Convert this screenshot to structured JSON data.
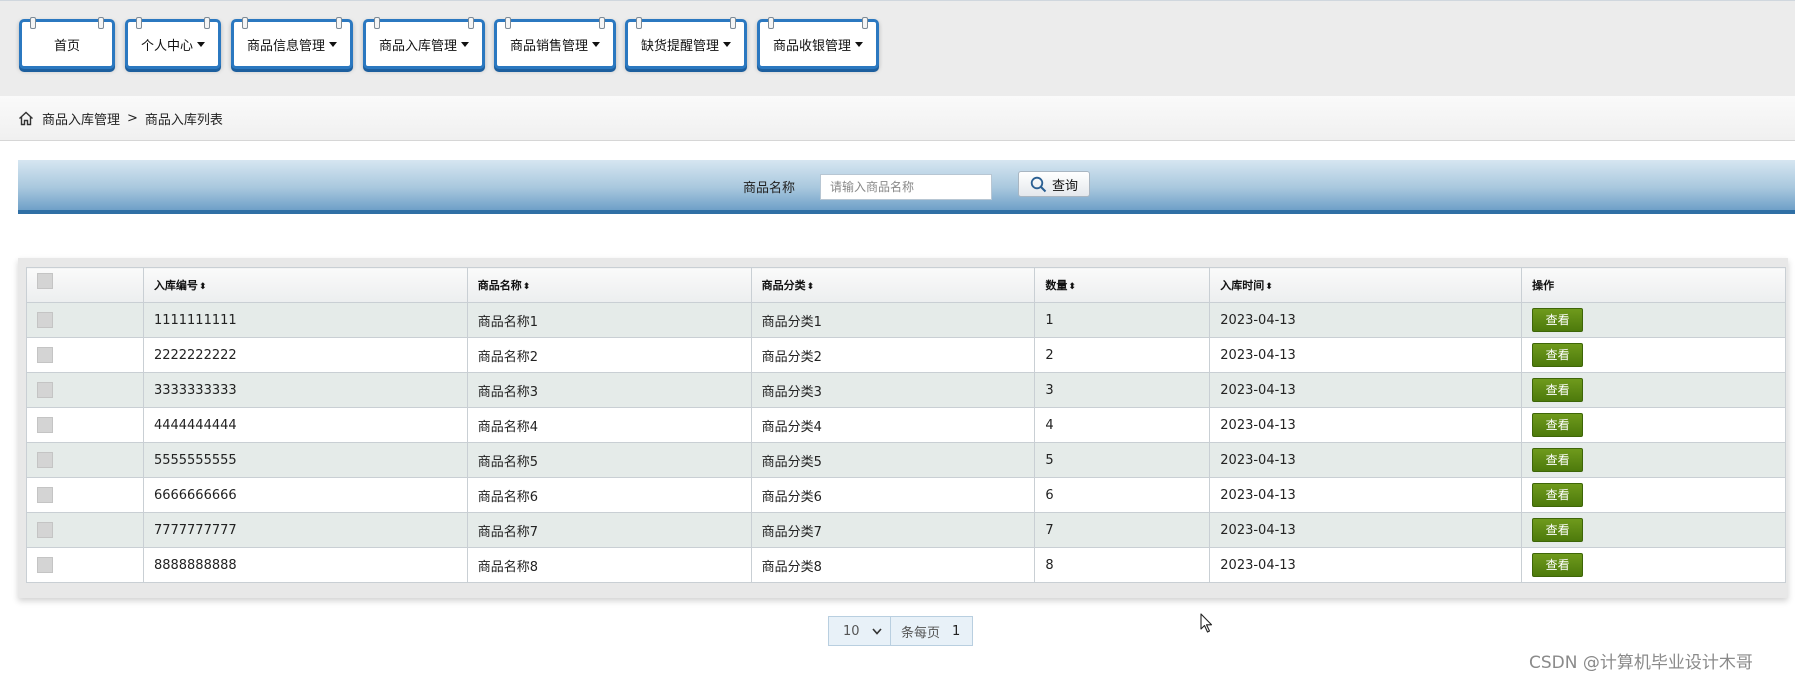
{
  "nav": {
    "tabs": [
      {
        "label": "首页",
        "has_dropdown": false
      },
      {
        "label": "个人中心",
        "has_dropdown": true
      },
      {
        "label": "商品信息管理",
        "has_dropdown": true
      },
      {
        "label": "商品入库管理",
        "has_dropdown": true
      },
      {
        "label": "商品销售管理",
        "has_dropdown": true
      },
      {
        "label": "缺货提醒管理",
        "has_dropdown": true
      },
      {
        "label": "商品收银管理",
        "has_dropdown": true
      }
    ]
  },
  "breadcrumb": {
    "icon": "home-icon",
    "items": [
      "商品入库管理",
      "商品入库列表"
    ],
    "separator": ">"
  },
  "search": {
    "label": "商品名称",
    "placeholder": "请输入商品名称",
    "value": "",
    "button_label": "查询",
    "button_icon": "search-icon"
  },
  "table": {
    "columns": [
      "",
      "入库编号",
      "商品名称",
      "商品分类",
      "数量",
      "入库时间",
      "操作"
    ],
    "sort_mark": "⬍",
    "rows": [
      {
        "id": "1111111111",
        "name": "商品名称1",
        "category": "商品分类1",
        "qty": "1",
        "time": "2023-04-13",
        "action": "查看"
      },
      {
        "id": "2222222222",
        "name": "商品名称2",
        "category": "商品分类2",
        "qty": "2",
        "time": "2023-04-13",
        "action": "查看"
      },
      {
        "id": "3333333333",
        "name": "商品名称3",
        "category": "商品分类3",
        "qty": "3",
        "time": "2023-04-13",
        "action": "查看"
      },
      {
        "id": "4444444444",
        "name": "商品名称4",
        "category": "商品分类4",
        "qty": "4",
        "time": "2023-04-13",
        "action": "查看"
      },
      {
        "id": "5555555555",
        "name": "商品名称5",
        "category": "商品分类5",
        "qty": "5",
        "time": "2023-04-13",
        "action": "查看"
      },
      {
        "id": "6666666666",
        "name": "商品名称6",
        "category": "商品分类6",
        "qty": "6",
        "time": "2023-04-13",
        "action": "查看"
      },
      {
        "id": "7777777777",
        "name": "商品名称7",
        "category": "商品分类7",
        "qty": "7",
        "time": "2023-04-13",
        "action": "查看"
      },
      {
        "id": "8888888888",
        "name": "商品名称8",
        "category": "商品分类8",
        "qty": "8",
        "time": "2023-04-13",
        "action": "查看"
      }
    ]
  },
  "pager": {
    "page_size": "10",
    "per_page_label": "条每页",
    "current_page": "1"
  },
  "watermark": "CSDN @计算机毕业设计木哥",
  "colors": {
    "nav_border": "#2b78c0",
    "search_gradient_bottom": "#2f6fa5",
    "view_button": "#5a8612",
    "odd_row": "#e5ebe9"
  }
}
